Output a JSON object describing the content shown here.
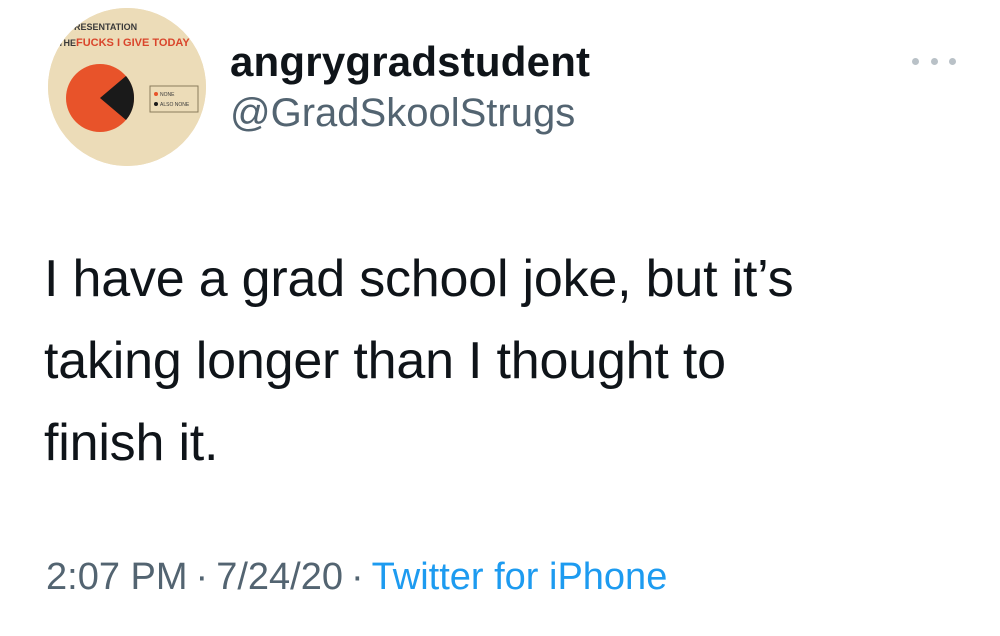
{
  "tweet": {
    "avatar": {
      "icon": "pie-chart-avatar-icon",
      "caption_top": "RESENTATION",
      "caption_the": "THE",
      "caption_main": "FUCKS I GIVE TODAY",
      "legend_1": "NONE",
      "legend_2": "ALSO NONE",
      "colors": {
        "background": "#ecdcb8",
        "slice_main": "#e8532a",
        "slice_dark": "#1a1a1a",
        "caption": "#d9452b"
      }
    },
    "display_name": "angrygradstudent",
    "handle": "@GradSkoolStrugs",
    "more_icon": "more-horizontal-icon",
    "text_lines": [
      "I have a grad school joke, but it’s",
      "taking longer than I thought to",
      "finish it."
    ],
    "time": "2:07 PM",
    "date": "7/24/20",
    "separator": "·",
    "source": "Twitter for iPhone",
    "colors": {
      "text": "#0f1419",
      "secondary": "#536471",
      "link": "#1d9bf0"
    }
  }
}
